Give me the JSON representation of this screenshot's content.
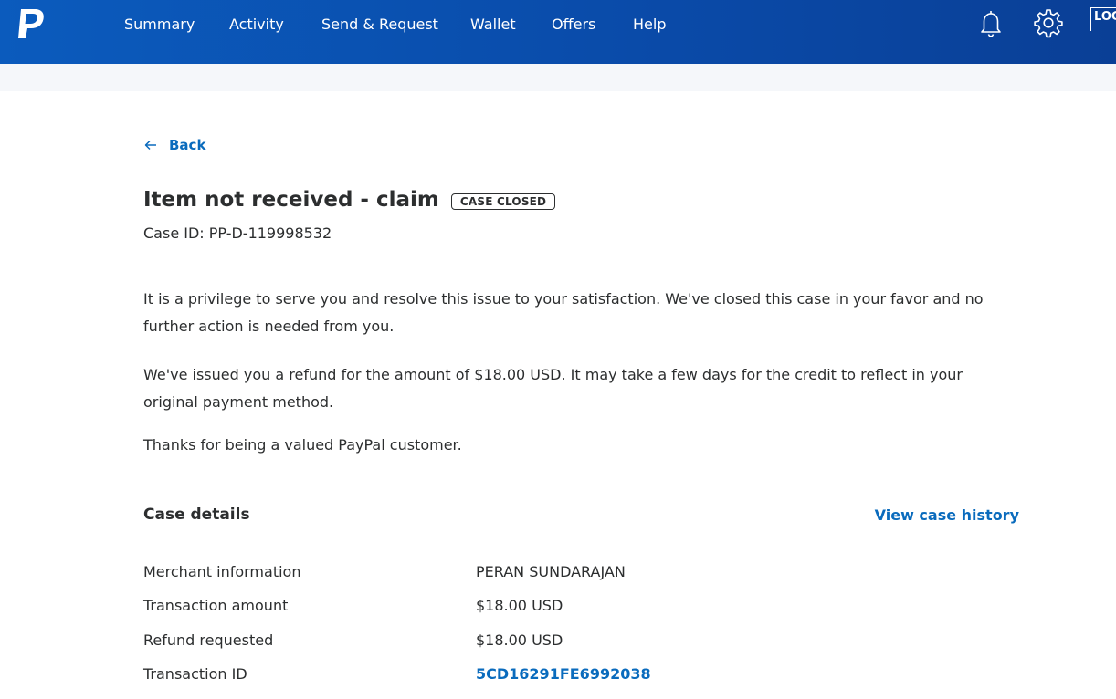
{
  "nav": {
    "items": [
      {
        "label": "Summary"
      },
      {
        "label": "Activity"
      },
      {
        "label": "Send & Request"
      },
      {
        "label": "Wallet"
      },
      {
        "label": "Offers"
      },
      {
        "label": "Help"
      }
    ],
    "notifications_icon": "bell-icon",
    "settings_icon": "gear-icon",
    "logout_label": "LOGOUT"
  },
  "back": {
    "label": "Back"
  },
  "case": {
    "title": "Item not received - claim",
    "status_badge": "CASE CLOSED",
    "case_id": "Case ID: PP-D-119998532"
  },
  "messages": {
    "p1": "It is a privilege to serve you and resolve this issue to your satisfaction. We've closed this case in your favor and no further action is needed from you.",
    "p2": "We've issued you a refund for the amount of $18.00 USD. It may take a few days for the credit to reflect in your original payment method.",
    "p3": "Thanks for being a valued PayPal customer."
  },
  "details": {
    "title": "Case details",
    "history_link": "View case history",
    "rows": [
      {
        "label": "Merchant information",
        "value": "PERAN SUNDARAJAN"
      },
      {
        "label": "Transaction amount",
        "value": "$18.00 USD"
      },
      {
        "label": "Refund requested",
        "value": "$18.00 USD"
      },
      {
        "label": "Transaction ID",
        "value": "5CD16291FE6992038"
      }
    ]
  },
  "colors": {
    "nav_blue": "#0a4aa8",
    "link_blue": "#0a6bbd",
    "text": "#2c2e2f"
  }
}
